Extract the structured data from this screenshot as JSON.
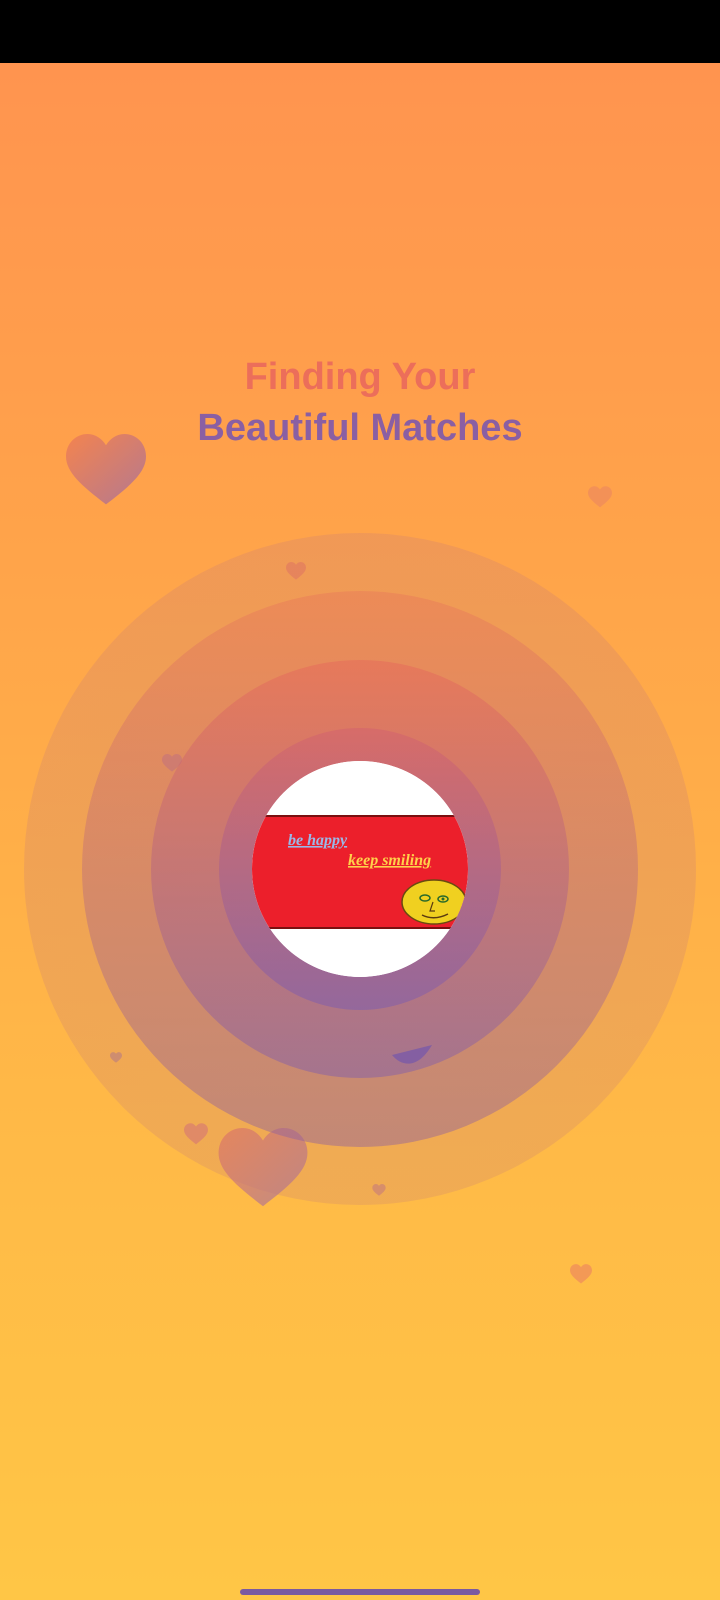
{
  "title": {
    "line1": "Finding Your",
    "line2": "Beautiful Matches"
  },
  "colors": {
    "title_line1": "#ec6e5a",
    "title_line2": "#8a5fa3",
    "background_top": "#ff9250",
    "background_bottom": "#ffc646"
  },
  "avatar": {
    "text_1": "be happy",
    "text_2": "keep smiling"
  },
  "icons": [
    "heart-icon",
    "smiley-icon"
  ]
}
